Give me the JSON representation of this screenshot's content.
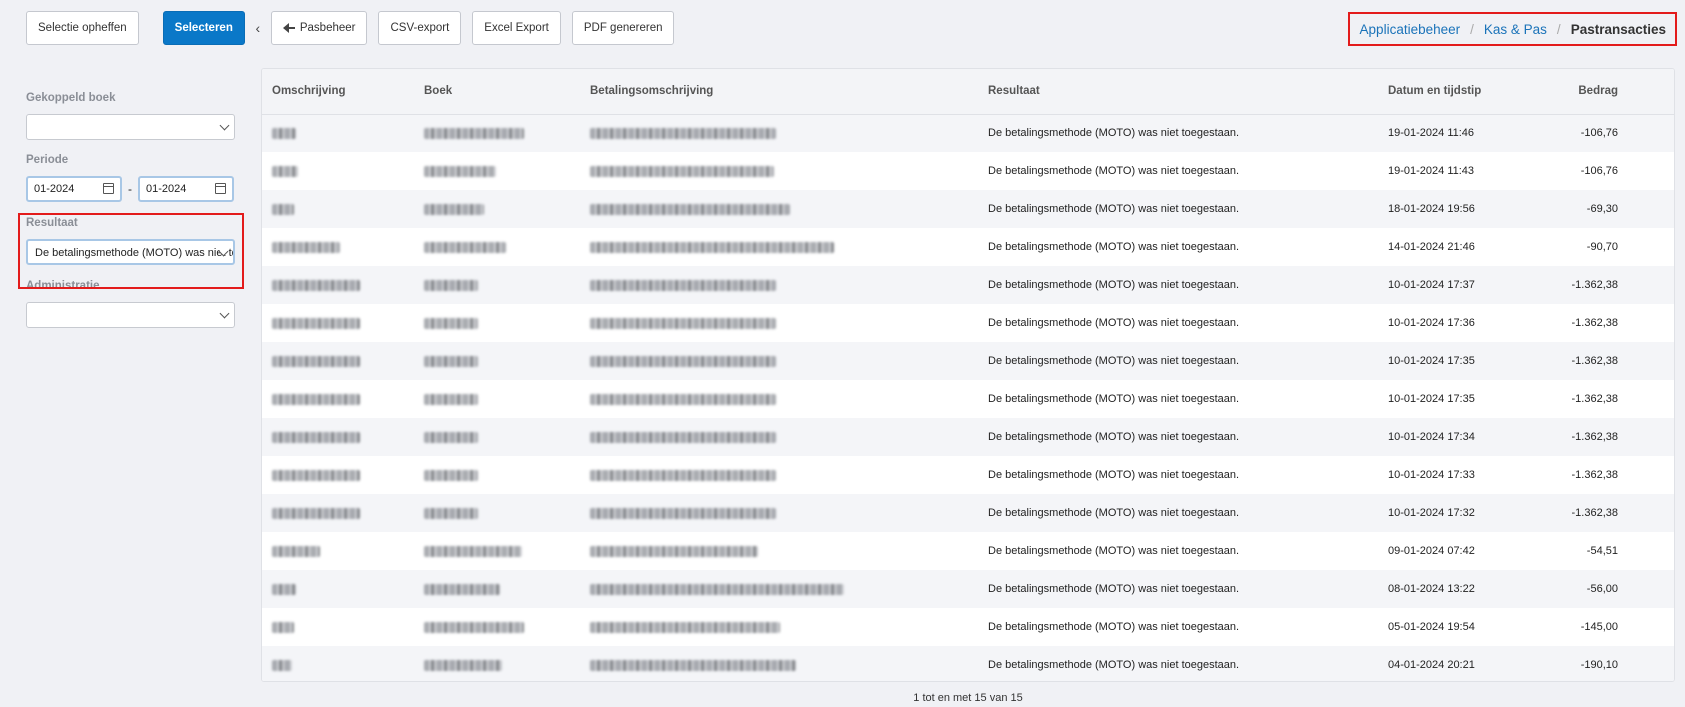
{
  "toolbar": {
    "clear_selection": "Selectie opheffen",
    "select": "Selecteren",
    "back": "Pasbeheer",
    "csv": "CSV-export",
    "excel": "Excel Export",
    "pdf": "PDF genereren"
  },
  "breadcrumb": {
    "item1": "Applicatiebeheer",
    "item2": "Kas & Pas",
    "current": "Pastransacties",
    "separator": "/"
  },
  "filters": {
    "book_label": "Gekoppeld boek",
    "book_value": "",
    "period_label": "Periode",
    "date_from": "01-2024",
    "date_to": "01-2024",
    "date_sep": "-",
    "result_label": "Resultaat",
    "result_value": "De betalingsmethode (MOTO) was niet toegestaan.",
    "admin_label": "Administratie",
    "admin_value": ""
  },
  "table": {
    "headers": {
      "description": "Omschrijving",
      "book": "Boek",
      "payment_description": "Betalingsomschrijving",
      "result": "Resultaat",
      "datetime": "Datum en tijdstip",
      "amount": "Bedrag"
    },
    "rows": [
      {
        "result": "De betalingsmethode (MOTO) was niet toegestaan.",
        "datetime": "19-01-2024 11:46",
        "amount": "-106,76"
      },
      {
        "result": "De betalingsmethode (MOTO) was niet toegestaan.",
        "datetime": "19-01-2024 11:43",
        "amount": "-106,76"
      },
      {
        "result": "De betalingsmethode (MOTO) was niet toegestaan.",
        "datetime": "18-01-2024 19:56",
        "amount": "-69,30"
      },
      {
        "result": "De betalingsmethode (MOTO) was niet toegestaan.",
        "datetime": "14-01-2024 21:46",
        "amount": "-90,70"
      },
      {
        "result": "De betalingsmethode (MOTO) was niet toegestaan.",
        "datetime": "10-01-2024 17:37",
        "amount": "-1.362,38"
      },
      {
        "result": "De betalingsmethode (MOTO) was niet toegestaan.",
        "datetime": "10-01-2024 17:36",
        "amount": "-1.362,38"
      },
      {
        "result": "De betalingsmethode (MOTO) was niet toegestaan.",
        "datetime": "10-01-2024 17:35",
        "amount": "-1.362,38"
      },
      {
        "result": "De betalingsmethode (MOTO) was niet toegestaan.",
        "datetime": "10-01-2024 17:35",
        "amount": "-1.362,38"
      },
      {
        "result": "De betalingsmethode (MOTO) was niet toegestaan.",
        "datetime": "10-01-2024 17:34",
        "amount": "-1.362,38"
      },
      {
        "result": "De betalingsmethode (MOTO) was niet toegestaan.",
        "datetime": "10-01-2024 17:33",
        "amount": "-1.362,38"
      },
      {
        "result": "De betalingsmethode (MOTO) was niet toegestaan.",
        "datetime": "10-01-2024 17:32",
        "amount": "-1.362,38"
      },
      {
        "result": "De betalingsmethode (MOTO) was niet toegestaan.",
        "datetime": "09-01-2024 07:42",
        "amount": "-54,51"
      },
      {
        "result": "De betalingsmethode (MOTO) was niet toegestaan.",
        "datetime": "08-01-2024 13:22",
        "amount": "-56,00"
      },
      {
        "result": "De betalingsmethode (MOTO) was niet toegestaan.",
        "datetime": "05-01-2024 19:54",
        "amount": "-145,00"
      },
      {
        "result": "De betalingsmethode (MOTO) was niet toegestaan.",
        "datetime": "04-01-2024 20:21",
        "amount": "-190,10"
      }
    ]
  },
  "pagination": "1 tot en met 15 van 15",
  "colors": {
    "primary": "#0a78c8",
    "link": "#1a73b9",
    "highlight": "#e31b1b",
    "focus_border": "#a8c7e6"
  },
  "icons": {
    "back": "arrow-left-icon",
    "collapse": "chevron-left-icon",
    "dropdown": "chevron-down-icon",
    "date": "calendar-icon"
  }
}
